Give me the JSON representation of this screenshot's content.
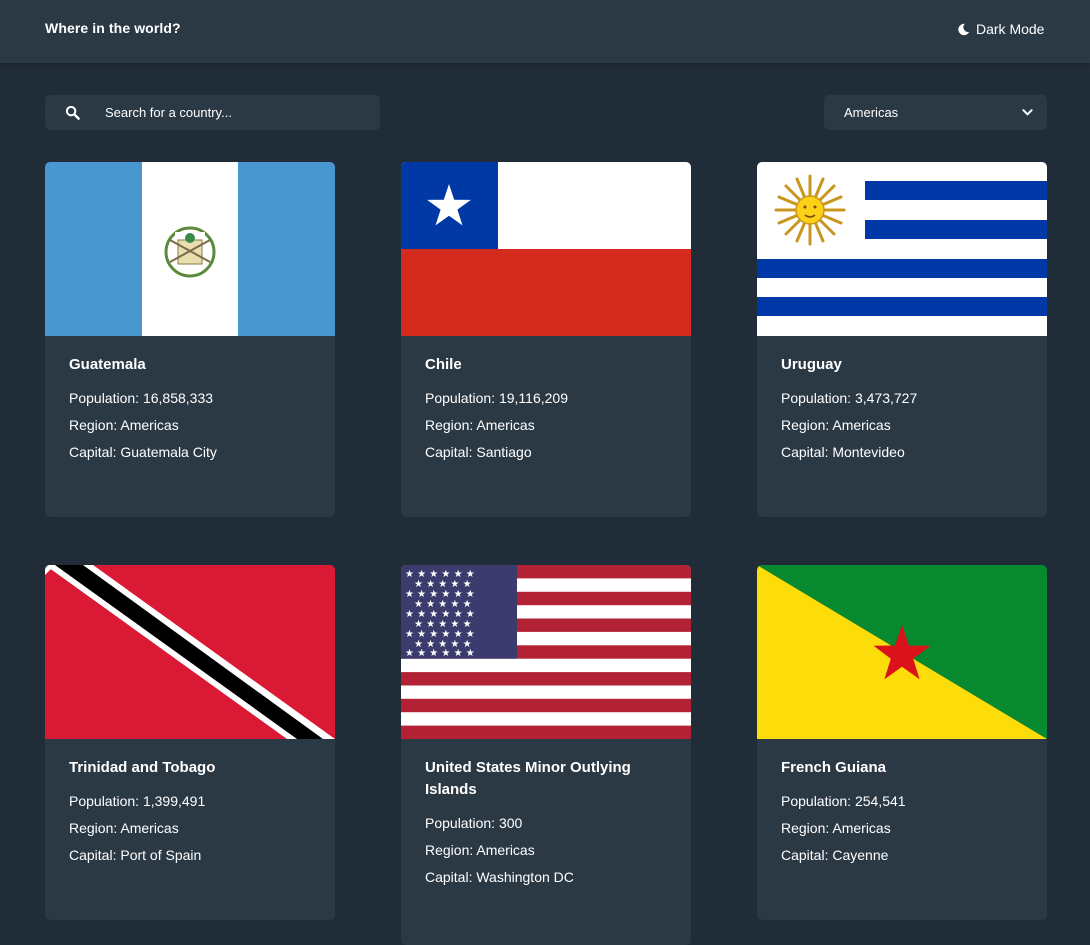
{
  "header": {
    "title": "Where in the world?",
    "mode_label": "Dark Mode"
  },
  "search": {
    "placeholder": "Search for a country..."
  },
  "filter": {
    "selected": "Americas"
  },
  "labels": {
    "population": "Population: ",
    "region": "Region: ",
    "capital": "Capital: "
  },
  "countries": [
    {
      "name": "Guatemala",
      "population": "16,858,333",
      "region": "Americas",
      "capital": "Guatemala City"
    },
    {
      "name": "Chile",
      "population": "19,116,209",
      "region": "Americas",
      "capital": "Santiago"
    },
    {
      "name": "Uruguay",
      "population": "3,473,727",
      "region": "Americas",
      "capital": "Montevideo"
    },
    {
      "name": "Trinidad and Tobago",
      "population": "1,399,491",
      "region": "Americas",
      "capital": "Port of Spain"
    },
    {
      "name": "United States Minor Outlying Islands",
      "population": "300",
      "region": "Americas",
      "capital": "Washington DC"
    },
    {
      "name": "French Guiana",
      "population": "254,541",
      "region": "Americas",
      "capital": "Cayenne"
    }
  ],
  "colors": {
    "background": "#202c37",
    "element": "#2b3945",
    "text": "#ffffff"
  }
}
